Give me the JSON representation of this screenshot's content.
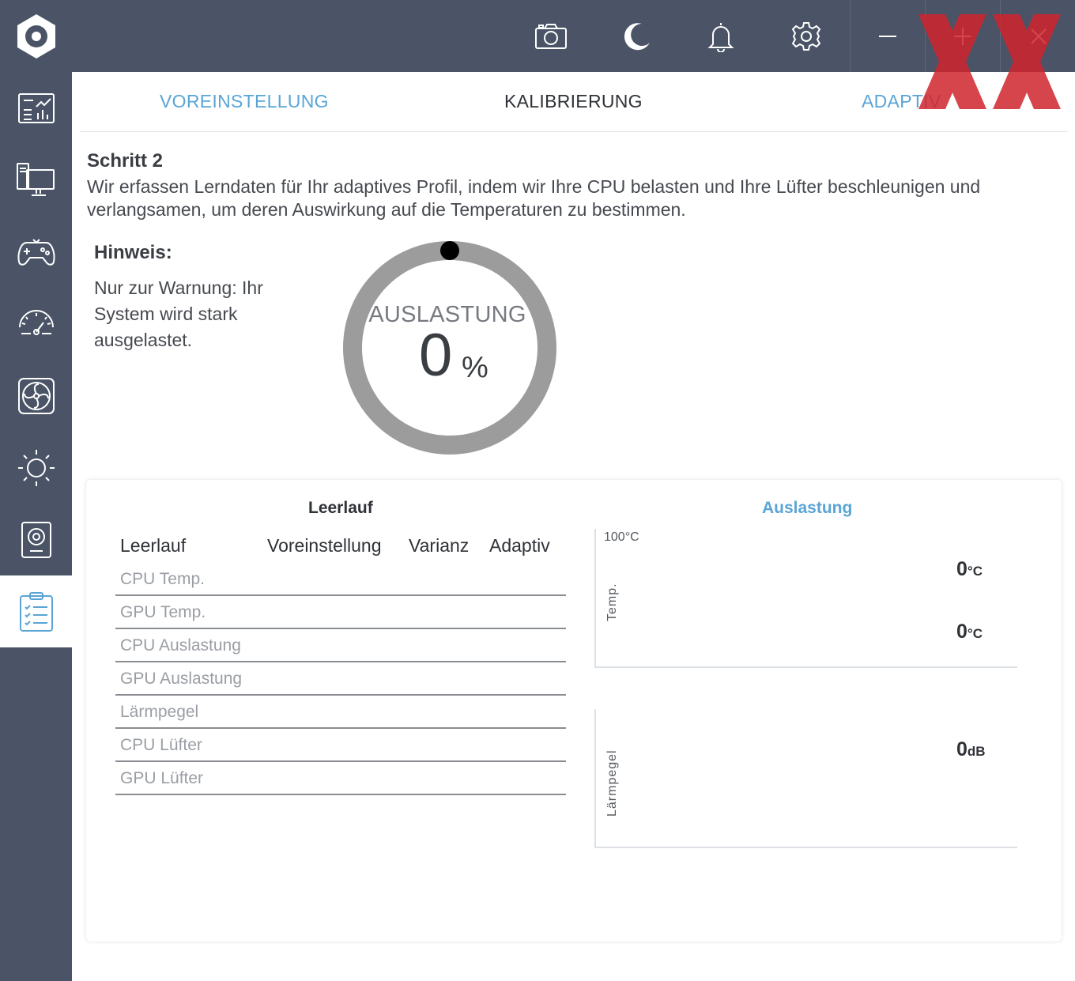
{
  "colors": {
    "chrome": "#4a5466",
    "accent": "#5aa5d6",
    "brand_red": "#d0252d"
  },
  "titlebar": {
    "icons": [
      "camera-icon",
      "moon-icon",
      "bell-icon",
      "gear-icon"
    ],
    "window": {
      "minimize": "–",
      "maximize": "+",
      "close": "×"
    }
  },
  "sidebar": {
    "items": [
      "dashboard-icon",
      "monitor-icon",
      "gamepad-icon",
      "speedometer-icon",
      "fan-icon",
      "brightness-icon",
      "speaker-icon",
      "clipboard-checklist-icon"
    ],
    "active_index": 7
  },
  "tabs": [
    {
      "label": "VOREINSTELLUNG",
      "state": "link"
    },
    {
      "label": "KALIBRIERUNG",
      "state": "current"
    },
    {
      "label": "ADAPTIV",
      "state": "link"
    }
  ],
  "step": {
    "title": "Schritt 2",
    "description": "Wir erfassen Lerndaten für Ihr adaptives Profil, indem wir Ihre CPU belasten und Ihre Lüfter beschleunigen und verlangsamen, um deren Auswirkung auf die Temperaturen zu bestimmen."
  },
  "hint": {
    "title": "Hinweis:",
    "text": "Nur zur Warnung: Ihr System wird stark ausgelastet."
  },
  "gauge": {
    "label": "AUSLASTUNG",
    "value": "0",
    "unit": "%",
    "progress": 0
  },
  "panel": {
    "left_heading": "Leerlauf",
    "right_heading": "Auslastung",
    "columns": [
      "Leerlauf",
      "Voreinstellung",
      "Varianz",
      "Adaptiv"
    ],
    "rows": [
      "CPU Temp.",
      "GPU Temp.",
      "CPU Auslastung",
      "GPU Auslastung",
      "Lärmpegel",
      "CPU Lüfter",
      "GPU Lüfter"
    ],
    "temp_chart": {
      "max_label": "100°C",
      "axis_title": "Temp.",
      "readings": [
        {
          "value": "0",
          "unit": "°C"
        },
        {
          "value": "0",
          "unit": "°C"
        }
      ]
    },
    "noise_chart": {
      "axis_title": "Lärmpegel",
      "reading": {
        "value": "0",
        "unit": "dB"
      }
    }
  }
}
